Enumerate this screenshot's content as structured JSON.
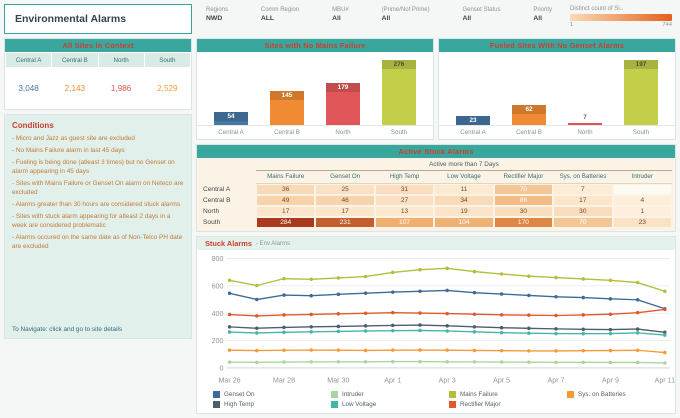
{
  "page": {
    "title": "Environmental Alarms"
  },
  "header": {
    "filters": [
      {
        "label": "Regions",
        "value": "NWD"
      },
      {
        "label": "Comm Region",
        "value": "ALL"
      },
      {
        "label": "MBU#",
        "value": "All"
      },
      {
        "label": "(Prime/Not Prime)",
        "value": "All"
      },
      {
        "label": "Genset Status",
        "value": "All"
      },
      {
        "label": "Priority",
        "value": "All"
      }
    ],
    "gradient_legend": {
      "label": "Distinct count of Si..",
      "min": "1",
      "max": "744",
      "colors": [
        "#fbdcb6",
        "#e2611b"
      ]
    }
  },
  "sites_context": {
    "title": "All Sites in Context",
    "columns": [
      "Central A",
      "Central B",
      "North",
      "South"
    ],
    "values": [
      "3,048",
      "2,143",
      "1,986",
      "2,529"
    ],
    "value_colors": [
      "#4679a8",
      "#ef8b33",
      "#e0564e",
      "#f09f36"
    ]
  },
  "conditions": {
    "title": "Conditions",
    "lines": [
      "- Micro and Jazz as guest site are excluded",
      "- No Mains Failure alarm in last 45 days",
      "- Fueling is being done (atleast 3 times) but no Genset on alarm appearing in 45 days",
      "- Sites with Mains Failure or Genset On alarm on Neteco are excluded",
      "- Alarms greater than 30 hours are considered stuck alarms",
      "- Sites with stuck alarm appearing for atleast 2 days in a week are considered problematic",
      "- Alarms occured on the same date as of Non-Telco PH date are excluded"
    ],
    "footer": "To Navigate: click and go to site details"
  },
  "chart_data": [
    {
      "id": "sites_no_mains_failure",
      "type": "bar",
      "title": "Sites with No Mains Failure",
      "categories": [
        "Central A",
        "Central B",
        "North",
        "South"
      ],
      "values": [
        54,
        145,
        179,
        276
      ],
      "colors": [
        "#4679a8",
        "#f08b33",
        "#e15759",
        "#c3cf4a"
      ],
      "ylim": [
        0,
        290
      ]
    },
    {
      "id": "fueled_sites_no_genset",
      "type": "bar",
      "title": "Fueled Sites With No Genset Alarms",
      "categories": [
        "Central A",
        "Central B",
        "North",
        "South"
      ],
      "values": [
        23,
        62,
        7,
        197
      ],
      "colors": [
        "#4679a8",
        "#f08b33",
        "#e15759",
        "#c3cf4a"
      ],
      "ylim": [
        0,
        207
      ]
    },
    {
      "id": "active_stuck_alarms",
      "type": "heatmap",
      "title": "Active Stuck Alarms",
      "band_label": "Active more than 7 Days",
      "columns": [
        "Mains Failure",
        "Genset On",
        "High Temp",
        "Low Voltage",
        "Rectifier Major",
        "Sys. on Batteries",
        "Intruder"
      ],
      "rows": [
        "Central A",
        "Central B",
        "North",
        "South"
      ],
      "values": [
        [
          36,
          25,
          31,
          11,
          70,
          7,
          null
        ],
        [
          49,
          46,
          27,
          34,
          86,
          17,
          4
        ],
        [
          17,
          17,
          13,
          19,
          30,
          30,
          1
        ],
        [
          284,
          231,
          107,
          104,
          170,
          70,
          23
        ]
      ],
      "color_scale": [
        "#fdf0dc",
        "#eb9a4e",
        "#a93a1e"
      ]
    },
    {
      "id": "stuck_alarms_trend",
      "type": "line",
      "title": "Stuck Alarms",
      "subtitle": "- Env Alarms",
      "x_ticks": [
        "Mar 26",
        "Mar 28",
        "Mar 30",
        "Apr 1",
        "Apr 3",
        "Apr 5",
        "Apr 7",
        "Apr 9",
        "Apr 11"
      ],
      "n_points": 17,
      "ylim": [
        0,
        800
      ],
      "y_ticks": [
        0,
        200,
        400,
        600,
        800
      ],
      "series": [
        {
          "name": "Genset On",
          "color": "#3c6a99",
          "values": [
            545,
            500,
            532,
            528,
            538,
            546,
            554,
            560,
            566,
            550,
            540,
            530,
            520,
            514,
            505,
            498,
            432
          ]
        },
        {
          "name": "High Temp",
          "color": "#4d5d6b",
          "values": [
            300,
            290,
            296,
            300,
            303,
            307,
            311,
            313,
            308,
            300,
            294,
            289,
            285,
            282,
            280,
            284,
            260
          ]
        },
        {
          "name": "Intruder",
          "color": "#a9d6a0",
          "values": [
            42,
            41,
            43,
            44,
            45,
            45,
            46,
            46,
            45,
            44,
            43,
            42,
            41,
            41,
            40,
            40,
            36
          ]
        },
        {
          "name": "Low Voltage",
          "color": "#47b4a9",
          "values": [
            262,
            255,
            260,
            264,
            267,
            270,
            272,
            274,
            270,
            264,
            258,
            254,
            251,
            250,
            251,
            256,
            240
          ]
        },
        {
          "name": "Mains Failure",
          "color": "#b4bd3c",
          "values": [
            640,
            602,
            652,
            648,
            658,
            668,
            698,
            718,
            728,
            704,
            686,
            670,
            660,
            650,
            640,
            624,
            560
          ]
        },
        {
          "name": "Rectifier Major",
          "color": "#e2592e",
          "values": [
            390,
            380,
            387,
            391,
            395,
            399,
            404,
            401,
            397,
            392,
            388,
            385,
            383,
            387,
            392,
            404,
            428
          ]
        },
        {
          "name": "Sys. on Batteries",
          "color": "#f29c37",
          "values": [
            130,
            127,
            129,
            131,
            130,
            128,
            130,
            131,
            130,
            128,
            126,
            125,
            125,
            126,
            127,
            129,
            112
          ]
        }
      ],
      "legend_order": [
        "Genset On",
        "Intruder",
        "Mains Failure",
        "Sys. on Batteries",
        "High Temp",
        "Low Voltage",
        "Rectifier Major"
      ]
    }
  ]
}
